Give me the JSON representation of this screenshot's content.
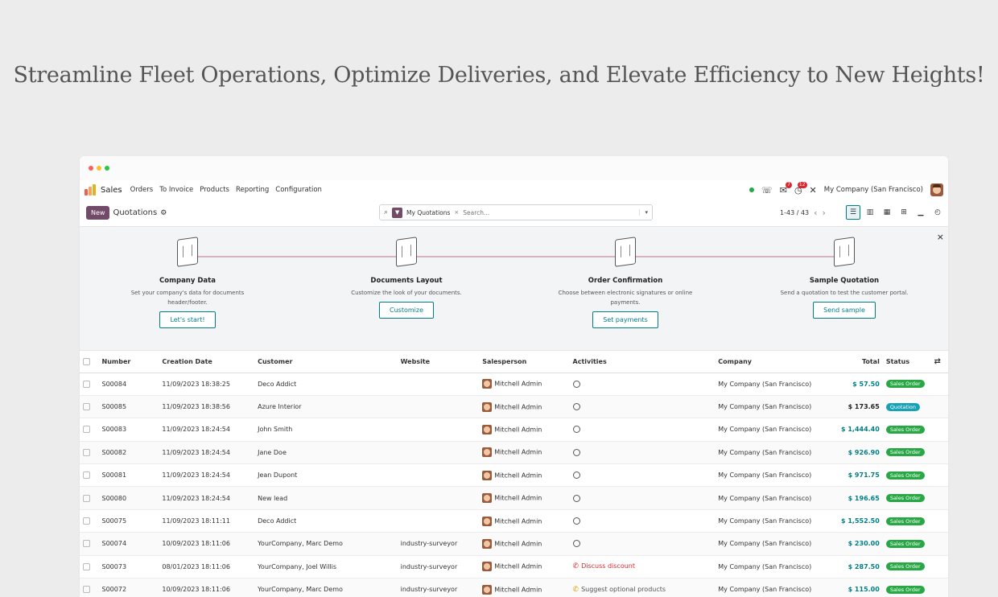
{
  "hero": {
    "text": "Streamline Fleet Operations, Optimize Deliveries, and Elevate Efficiency to New Heights!"
  },
  "window": {
    "dots": [
      "#ff5f57",
      "#febc2e",
      "#28c840"
    ]
  },
  "topbar": {
    "app": "Sales",
    "menu": [
      "Orders",
      "To Invoice",
      "Products",
      "Reporting",
      "Configuration"
    ],
    "chat_badge": "7",
    "activity_badge": "12",
    "company": "My Company (San Francisco)"
  },
  "control": {
    "new_label": "New",
    "title": "Quotations",
    "facet": "My Quotations",
    "search_placeholder": "Search...",
    "pager": "1-43 / 43"
  },
  "onboarding": {
    "steps": [
      {
        "title": "Company Data",
        "desc": "Set your company's data for documents header/footer.",
        "button": "Let's start!"
      },
      {
        "title": "Documents Layout",
        "desc": "Customize the look of your documents.",
        "button": "Customize"
      },
      {
        "title": "Order Confirmation",
        "desc": "Choose between electronic signatures or online payments.",
        "button": "Set payments"
      },
      {
        "title": "Sample Quotation",
        "desc": "Send a quotation to test the customer portal.",
        "button": "Send sample"
      }
    ]
  },
  "table": {
    "columns": [
      "Number",
      "Creation Date",
      "Customer",
      "Website",
      "Salesperson",
      "Activities",
      "Company",
      "Total",
      "Status"
    ],
    "rows": [
      {
        "number": "S00084",
        "date": "11/09/2023 18:38:25",
        "customer": "Deco Addict",
        "website": "",
        "salesperson": "Mitchell Admin",
        "activity": "",
        "company": "My Company (San Francisco)",
        "total": "$ 57.50",
        "status": "Sales Order"
      },
      {
        "number": "S00085",
        "date": "11/09/2023 18:38:56",
        "customer": "Azure Interior",
        "website": "",
        "salesperson": "Mitchell Admin",
        "activity": "",
        "company": "My Company (San Francisco)",
        "total": "$ 173.65",
        "status": "Quotation"
      },
      {
        "number": "S00083",
        "date": "11/09/2023 18:24:54",
        "customer": "John Smith",
        "website": "",
        "salesperson": "Mitchell Admin",
        "activity": "",
        "company": "My Company (San Francisco)",
        "total": "$ 1,444.40",
        "status": "Sales Order"
      },
      {
        "number": "S00082",
        "date": "11/09/2023 18:24:54",
        "customer": "Jane Doe",
        "website": "",
        "salesperson": "Mitchell Admin",
        "activity": "",
        "company": "My Company (San Francisco)",
        "total": "$ 926.90",
        "status": "Sales Order"
      },
      {
        "number": "S00081",
        "date": "11/09/2023 18:24:54",
        "customer": "Jean Dupont",
        "website": "",
        "salesperson": "Mitchell Admin",
        "activity": "",
        "company": "My Company (San Francisco)",
        "total": "$ 971.75",
        "status": "Sales Order"
      },
      {
        "number": "S00080",
        "date": "11/09/2023 18:24:54",
        "customer": "New lead",
        "website": "",
        "salesperson": "Mitchell Admin",
        "activity": "",
        "company": "My Company (San Francisco)",
        "total": "$ 196.65",
        "status": "Sales Order"
      },
      {
        "number": "S00075",
        "date": "11/09/2023 18:11:11",
        "customer": "Deco Addict",
        "website": "",
        "salesperson": "Mitchell Admin",
        "activity": "",
        "company": "My Company (San Francisco)",
        "total": "$ 1,552.50",
        "status": "Sales Order"
      },
      {
        "number": "S00074",
        "date": "10/09/2023 18:11:06",
        "customer": "YourCompany, Marc Demo",
        "website": "industry-surveyor",
        "salesperson": "Mitchell Admin",
        "activity": "",
        "company": "My Company (San Francisco)",
        "total": "$ 230.00",
        "status": "Sales Order"
      },
      {
        "number": "S00073",
        "date": "08/01/2023 18:11:06",
        "customer": "YourCompany, Joel Willis",
        "website": "industry-surveyor",
        "salesperson": "Mitchell Admin",
        "activity": "Discuss discount",
        "company": "My Company (San Francisco)",
        "total": "$ 287.50",
        "status": "Sales Order"
      },
      {
        "number": "S00072",
        "date": "10/09/2023 18:11:06",
        "customer": "YourCompany, Marc Demo",
        "website": "industry-surveyor",
        "salesperson": "Mitchell Admin",
        "activity": "Suggest optional products",
        "company": "My Company (San Francisco)",
        "total": "$ 115.00",
        "status": "Sales Order"
      }
    ]
  },
  "colors": {
    "brand": "#714b67",
    "accent": "#017e84",
    "sales_order": "#28a745",
    "quotation": "#17a2b8"
  }
}
